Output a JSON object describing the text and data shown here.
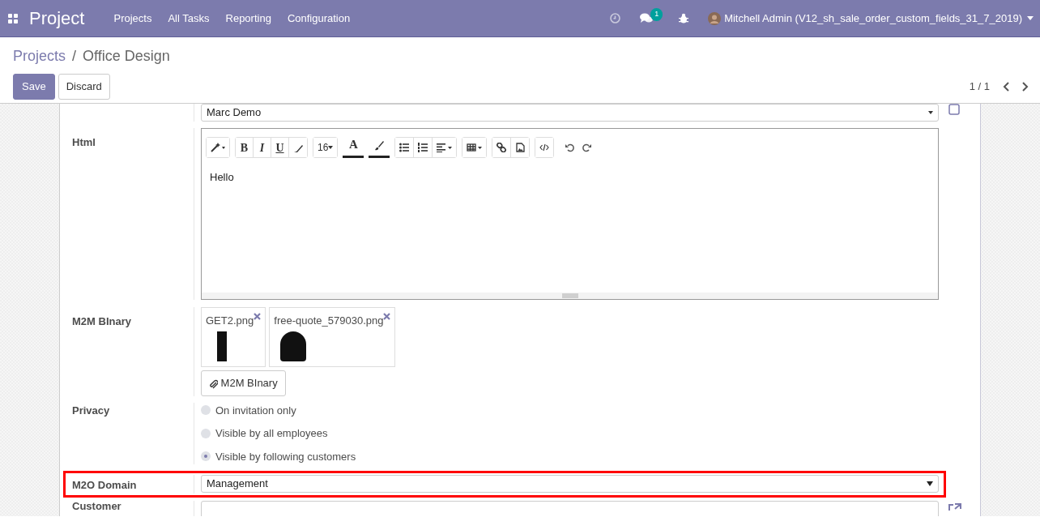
{
  "navbar": {
    "app_title": "Project",
    "menu": [
      {
        "label": "Projects"
      },
      {
        "label": "All Tasks"
      },
      {
        "label": "Reporting"
      },
      {
        "label": "Configuration"
      }
    ],
    "message_count": "1",
    "user": "Mitchell Admin (V12_sh_sale_order_custom_fields_31_7_2019)"
  },
  "breadcrumb": {
    "parent": "Projects",
    "separator": "/",
    "current": "Office Design"
  },
  "buttons": {
    "save": "Save",
    "discard": "Discard"
  },
  "pager": "1 / 1",
  "form": {
    "top_field_value": "Marc Demo",
    "html": {
      "label": "Html",
      "toolbar": {
        "font_size": "16",
        "bold": "B",
        "italic": "I",
        "underline": "U",
        "font_color": "A"
      },
      "content": "Hello"
    },
    "m2m_binary": {
      "label": "M2M BInary",
      "files": [
        {
          "name": "GET2.png"
        },
        {
          "name": "free-quote_579030.png"
        }
      ],
      "upload_button": "M2M BInary"
    },
    "privacy": {
      "label": "Privacy",
      "options": [
        {
          "label": "On invitation only",
          "selected": false
        },
        {
          "label": "Visible by all employees",
          "selected": false
        },
        {
          "label": "Visible by following customers",
          "selected": true
        }
      ]
    },
    "m2o_domain": {
      "label": "M2O Domain",
      "value": "Management",
      "highlighted": true
    },
    "customer": {
      "label": "Customer"
    }
  }
}
